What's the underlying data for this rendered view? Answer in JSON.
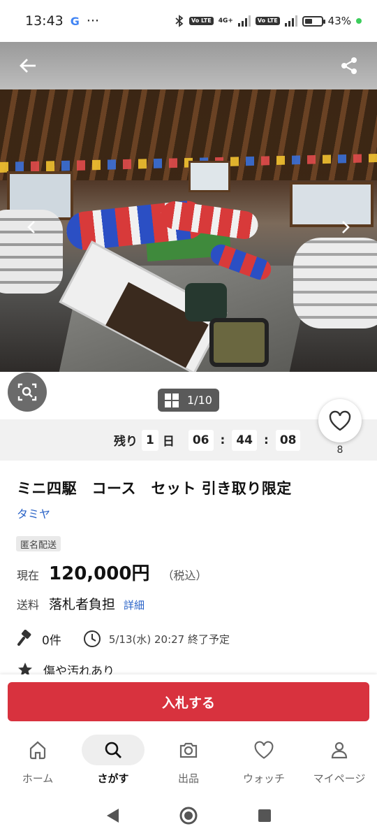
{
  "status_bar": {
    "time": "13:43",
    "google": "G",
    "more": "···",
    "volte1": "Vo LTE",
    "net": "4G+",
    "volte2": "Vo LTE",
    "battery": "43%"
  },
  "hero": {
    "image_counter": "1/10",
    "current_image": 1,
    "total_images": 10
  },
  "timer": {
    "remaining_label": "残り",
    "days": "1",
    "days_unit": "日",
    "hours": "06",
    "minutes": "44",
    "seconds": "08"
  },
  "favorite": {
    "count": "8"
  },
  "listing": {
    "title": "ミニ四駆　コース　セット 引き取り限定",
    "brand": "タミヤ",
    "anon_badge": "匿名配送",
    "price_label": "現在",
    "price": "120,000円",
    "tax": "（税込）",
    "shipping_label": "送料",
    "shipping_value": "落札者負担",
    "shipping_link": "詳細",
    "bids": "0件",
    "end_time": "5/13(水) 20:27 終了予定",
    "condition": "傷や汚れあり"
  },
  "bid_button": {
    "label": "入札する"
  },
  "bottom_nav": {
    "items": [
      {
        "label": "ホーム",
        "icon": "home-icon"
      },
      {
        "label": "さがす",
        "icon": "search-icon"
      },
      {
        "label": "出品",
        "icon": "camera-icon"
      },
      {
        "label": "ウォッチ",
        "icon": "heart-icon"
      },
      {
        "label": "マイページ",
        "icon": "person-icon"
      }
    ],
    "active_index": 1
  },
  "colors": {
    "accent_red": "#d8323e",
    "link_blue": "#2a63c7"
  }
}
